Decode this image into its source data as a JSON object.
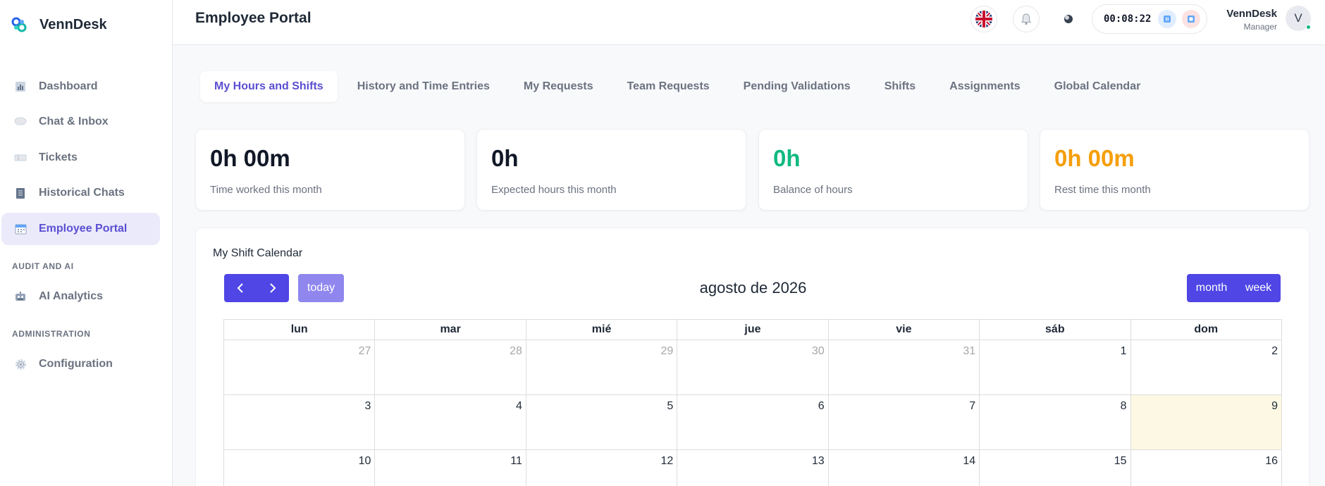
{
  "brand": {
    "name": "VennDesk"
  },
  "sidebar": {
    "items": [
      {
        "label": "Dashboard",
        "icon": "bar-chart-icon",
        "active": false
      },
      {
        "label": "Chat & Inbox",
        "icon": "speech-bubble-icon",
        "active": false
      },
      {
        "label": "Tickets",
        "icon": "ticket-icon",
        "active": false
      },
      {
        "label": "Historical Chats",
        "icon": "document-icon",
        "active": false
      },
      {
        "label": "Employee Portal",
        "icon": "calendar-icon",
        "active": true
      }
    ],
    "section_audit": "AUDIT AND AI",
    "audit_items": [
      {
        "label": "AI Analytics",
        "icon": "robot-icon"
      }
    ],
    "section_admin": "ADMINISTRATION",
    "admin_items": [
      {
        "label": "Configuration",
        "icon": "gear-icon"
      }
    ]
  },
  "header": {
    "title": "Employee Portal",
    "timer": "00:08:22",
    "user_name": "VennDesk",
    "user_role": "Manager",
    "avatar_initial": "V"
  },
  "tabs": [
    {
      "label": "My Hours and Shifts",
      "active": true
    },
    {
      "label": "History and Time Entries",
      "active": false
    },
    {
      "label": "My Requests",
      "active": false
    },
    {
      "label": "Team Requests",
      "active": false
    },
    {
      "label": "Pending Validations",
      "active": false
    },
    {
      "label": "Shifts",
      "active": false
    },
    {
      "label": "Assignments",
      "active": false
    },
    {
      "label": "Global Calendar",
      "active": false
    }
  ],
  "stats": [
    {
      "value": "0h 00m",
      "label": "Time worked this month",
      "color": "#111827"
    },
    {
      "value": "0h",
      "label": "Expected hours this month",
      "color": "#111827"
    },
    {
      "value": "0h",
      "label": "Balance of hours",
      "color": "#10b981"
    },
    {
      "value": "0h 00m",
      "label": "Rest time this month",
      "color": "#f59e0b"
    }
  ],
  "calendar": {
    "title": "My Shift Calendar",
    "today_label": "today",
    "month_title": "agosto de 2026",
    "view_month": "month",
    "view_week": "week",
    "weekdays": [
      "lun",
      "mar",
      "mié",
      "jue",
      "vie",
      "sáb",
      "dom"
    ],
    "weeks": [
      [
        {
          "d": "27",
          "other": true
        },
        {
          "d": "28",
          "other": true
        },
        {
          "d": "29",
          "other": true
        },
        {
          "d": "30",
          "other": true
        },
        {
          "d": "31",
          "other": true
        },
        {
          "d": "1"
        },
        {
          "d": "2"
        }
      ],
      [
        {
          "d": "3"
        },
        {
          "d": "4"
        },
        {
          "d": "5"
        },
        {
          "d": "6"
        },
        {
          "d": "7"
        },
        {
          "d": "8"
        },
        {
          "d": "9",
          "today": true
        }
      ],
      [
        {
          "d": "10"
        },
        {
          "d": "11"
        },
        {
          "d": "12"
        },
        {
          "d": "13"
        },
        {
          "d": "14"
        },
        {
          "d": "15"
        },
        {
          "d": "16"
        }
      ]
    ]
  }
}
